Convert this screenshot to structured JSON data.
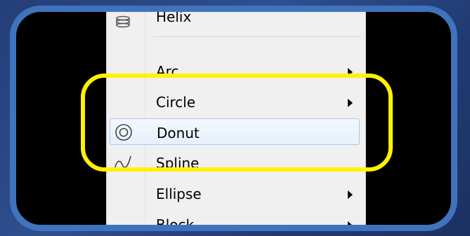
{
  "menu": {
    "items": [
      {
        "label": "Helix",
        "icon": "helix-icon",
        "submenu": false
      },
      {
        "label": "Arc",
        "icon": "",
        "submenu": true
      },
      {
        "label": "Circle",
        "icon": "",
        "submenu": true
      },
      {
        "label": "Donut",
        "icon": "donut-icon",
        "submenu": false,
        "hovered": true
      },
      {
        "label": "Spline",
        "icon": "spline-icon",
        "submenu": false
      },
      {
        "label": "Ellipse",
        "icon": "",
        "submenu": true
      },
      {
        "label": "Block",
        "icon": "",
        "submenu": true
      }
    ]
  },
  "colors": {
    "frame_border": "#3f73bd",
    "highlight_outline": "#fff200",
    "menu_background": "#f0f0f0",
    "hover_border": "#a8c8ec"
  }
}
